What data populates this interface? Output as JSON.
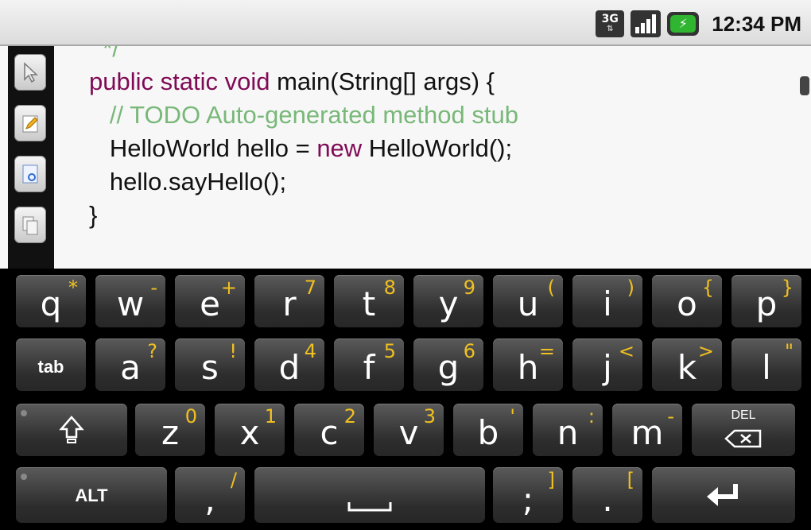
{
  "status_bar": {
    "network": "3G",
    "battery_charging": true,
    "time": "12:34 PM"
  },
  "editor": {
    "code_lines": [
      [
        {
          "t": "  */",
          "c": "cm"
        }
      ],
      [
        {
          "t": "public static void ",
          "c": "kw"
        },
        {
          "t": "main(String[] args) {",
          "c": ""
        }
      ],
      [
        {
          "t": "   // TODO Auto-generated method stub",
          "c": "cm"
        }
      ],
      [
        {
          "t": "   HelloWorld hello = ",
          "c": ""
        },
        {
          "t": "new",
          "c": "kw"
        },
        {
          "t": " HelloWorld();",
          "c": ""
        }
      ],
      [
        {
          "t": "   hello.sayHello();",
          "c": ""
        }
      ],
      [
        {
          "t": "",
          "c": ""
        }
      ],
      [
        {
          "t": "}",
          "c": ""
        }
      ]
    ],
    "tools": [
      "cursor-icon",
      "pencil-icon",
      "document-search-icon",
      "copy-icon"
    ],
    "colors": {
      "keyword": "#7f0a55",
      "comment": "#78b878",
      "text": "#111111"
    }
  },
  "keyboard": {
    "row1": [
      {
        "main": "q",
        "alt": "*"
      },
      {
        "main": "w",
        "alt": "-"
      },
      {
        "main": "e",
        "alt": "+"
      },
      {
        "main": "r",
        "alt": "7"
      },
      {
        "main": "t",
        "alt": "8"
      },
      {
        "main": "y",
        "alt": "9"
      },
      {
        "main": "u",
        "alt": "("
      },
      {
        "main": "i",
        "alt": ")"
      },
      {
        "main": "o",
        "alt": "{"
      },
      {
        "main": "p",
        "alt": "}"
      }
    ],
    "row2": [
      {
        "main": "tab",
        "alt": ""
      },
      {
        "main": "a",
        "alt": "?"
      },
      {
        "main": "s",
        "alt": "!"
      },
      {
        "main": "d",
        "alt": "4"
      },
      {
        "main": "f",
        "alt": "5"
      },
      {
        "main": "g",
        "alt": "6"
      },
      {
        "main": "h",
        "alt": "="
      },
      {
        "main": "j",
        "alt": "<"
      },
      {
        "main": "k",
        "alt": ">"
      },
      {
        "main": "l",
        "alt": "\""
      }
    ],
    "row3": [
      {
        "main": "z",
        "alt": "0"
      },
      {
        "main": "x",
        "alt": "1"
      },
      {
        "main": "c",
        "alt": "2"
      },
      {
        "main": "v",
        "alt": "3"
      },
      {
        "main": "b",
        "alt": "'"
      },
      {
        "main": "n",
        "alt": ":"
      },
      {
        "main": "m",
        "alt": "-"
      }
    ],
    "del_label": "DEL",
    "alt_label": "ALT",
    "row4_keys": [
      {
        "main": ",",
        "alt": "/"
      },
      {
        "main": ";",
        "alt": "]"
      },
      {
        "main": ".",
        "alt": "["
      }
    ]
  }
}
